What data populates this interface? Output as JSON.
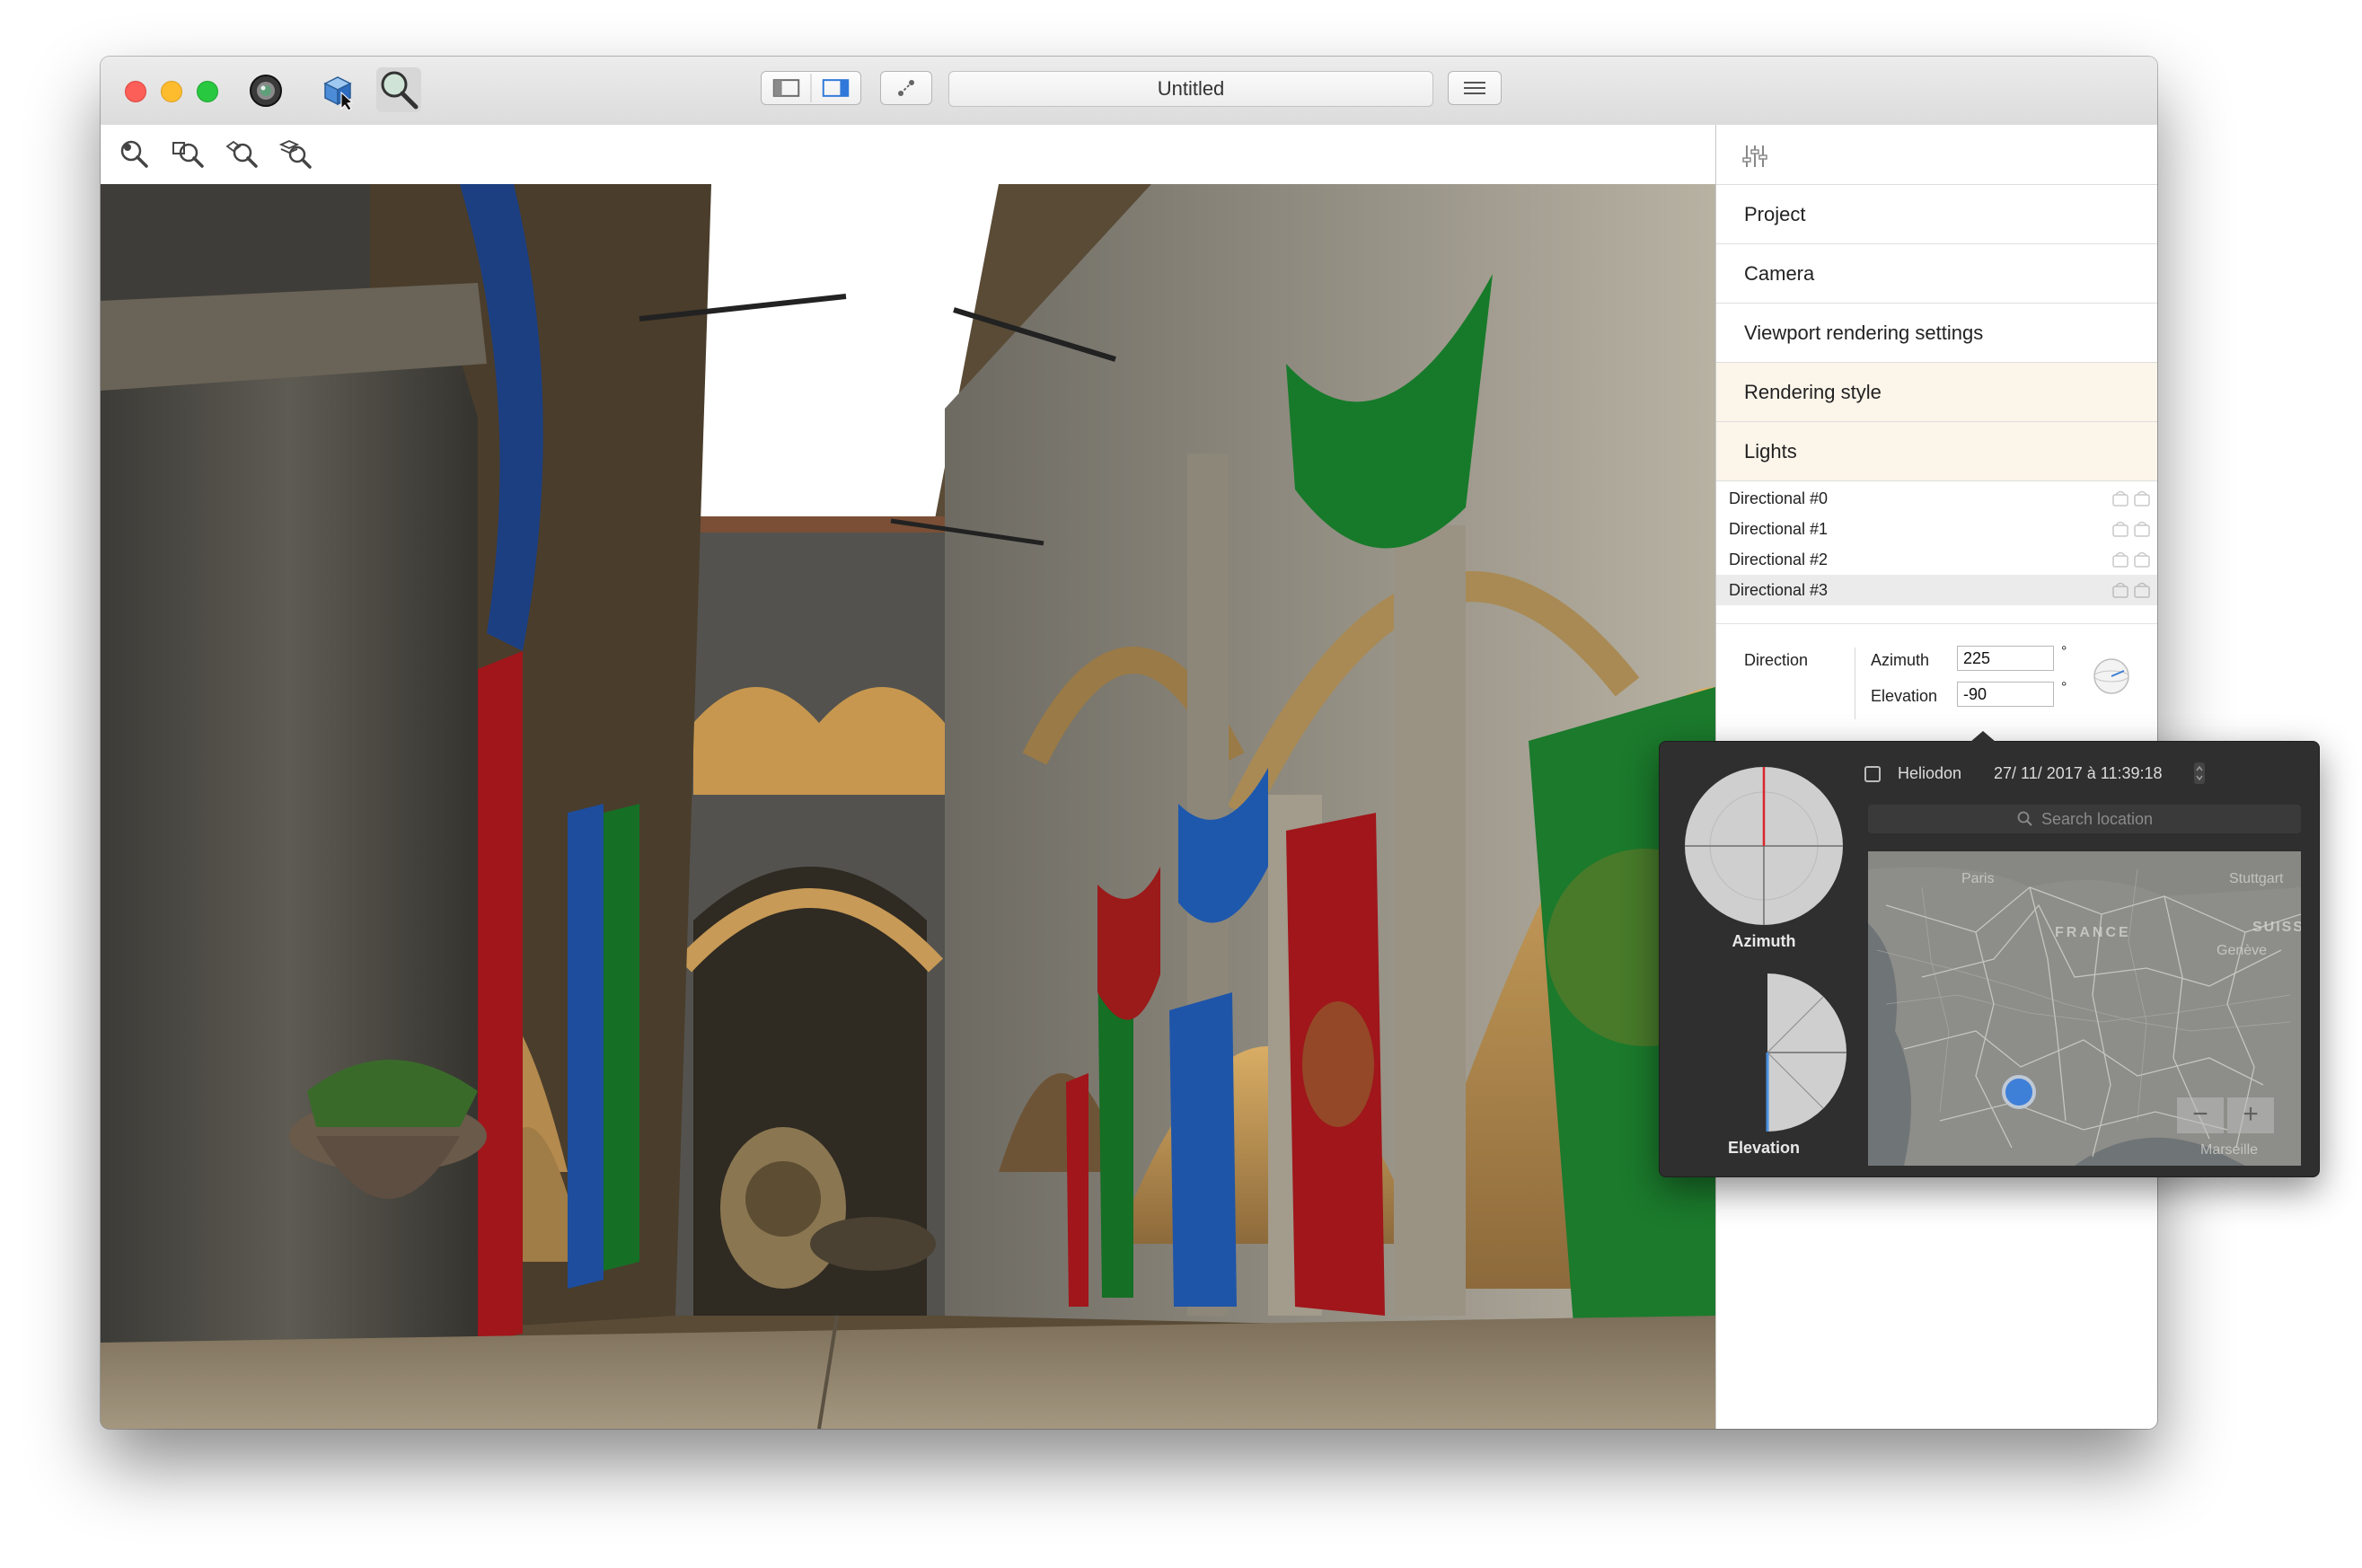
{
  "window": {
    "title": "Untitled"
  },
  "panel": {
    "sections": [
      {
        "label": "Project"
      },
      {
        "label": "Camera"
      },
      {
        "label": "Viewport rendering settings"
      },
      {
        "label": "Rendering style"
      },
      {
        "label": "Lights"
      }
    ],
    "lights": [
      {
        "label": "Directional #0"
      },
      {
        "label": "Directional #1"
      },
      {
        "label": "Directional #2"
      },
      {
        "label": "Directional #3"
      }
    ],
    "direction": {
      "label": "Direction",
      "azimuth_label": "Azimuth",
      "azimuth_value": "225",
      "elevation_label": "Elevation",
      "elevation_value": "-90",
      "unit": "°"
    }
  },
  "popover": {
    "azimuth_label": "Azimuth",
    "elevation_label": "Elevation",
    "heliodon_label": "Heliodon",
    "datetime": "27/ 11/ 2017 à  11:39:18",
    "search_placeholder": "Search location",
    "map_labels": {
      "paris": "Paris",
      "stuttgart": "Stuttgart",
      "france": "FRANCE",
      "suisse": "SUISS",
      "geneve": "Genève",
      "marseille": "Marseille"
    },
    "zoom_out": "−",
    "zoom_in": "+"
  },
  "colors": {
    "accent_red": "#d8262a",
    "section_tint": "#fcf5ea",
    "popover_bg": "#2f2f2f"
  }
}
